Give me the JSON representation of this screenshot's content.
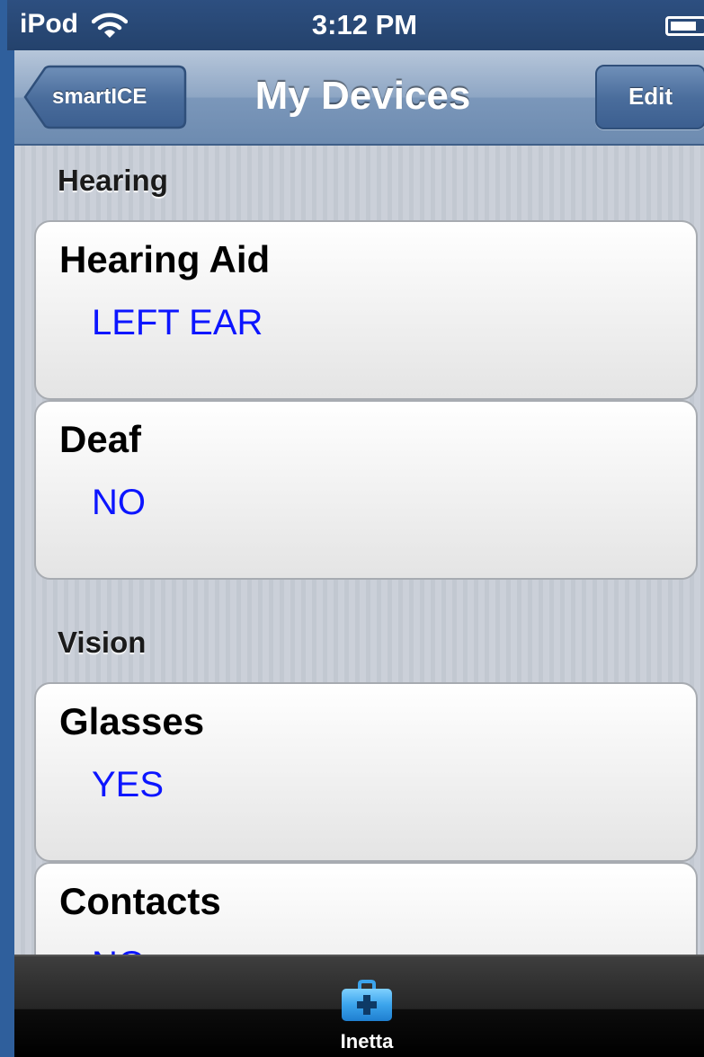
{
  "status_bar": {
    "carrier": "iPod",
    "time": "3:12 PM"
  },
  "nav": {
    "back_label": "smartICE",
    "title": "My Devices",
    "edit_label": "Edit"
  },
  "sections": [
    {
      "header": "Hearing",
      "items": [
        {
          "title": "Hearing Aid",
          "value": "LEFT EAR"
        },
        {
          "title": "Deaf",
          "value": "NO"
        }
      ]
    },
    {
      "header": "Vision",
      "items": [
        {
          "title": "Glasses",
          "value": "YES"
        },
        {
          "title": "Contacts",
          "value": "NO"
        }
      ]
    }
  ],
  "tab_bar": {
    "items": [
      {
        "label": "Inetta",
        "icon": "medical-kit-icon",
        "selected": true
      }
    ]
  },
  "colors": {
    "value_text": "#0c15ff",
    "nav_bar": "#7b97ba",
    "tab_bar": "#1a1a1a"
  }
}
